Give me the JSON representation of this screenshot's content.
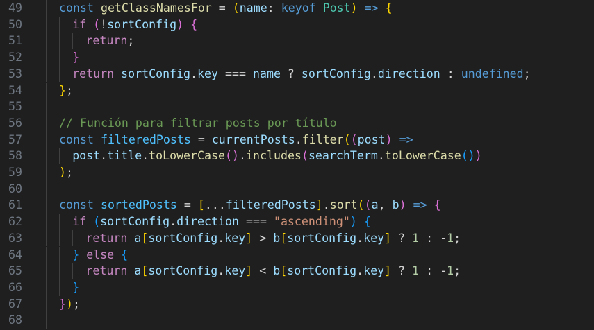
{
  "editor": {
    "line_numbers": [
      "49",
      "50",
      "51",
      "52",
      "53",
      "54",
      "55",
      "56",
      "57",
      "58",
      "59",
      "60",
      "61",
      "62",
      "63",
      "64",
      "65",
      "66",
      "67",
      "68"
    ],
    "lines": [
      {
        "indent": 0,
        "tokens": [
          [
            "kw",
            "const "
          ],
          [
            "fn",
            "getClassNamesFor"
          ],
          [
            "op",
            " = "
          ],
          [
            "b1",
            "("
          ],
          [
            "var",
            "name"
          ],
          [
            "op",
            ": "
          ],
          [
            "kw",
            "keyof "
          ],
          [
            "typ",
            "Post"
          ],
          [
            "b1",
            ")"
          ],
          [
            "op",
            " "
          ],
          [
            "kw",
            "=>"
          ],
          [
            "op",
            " "
          ],
          [
            "b1",
            "{"
          ]
        ]
      },
      {
        "indent": 1,
        "tokens": [
          [
            "ctl",
            "if "
          ],
          [
            "b2",
            "("
          ],
          [
            "op",
            "!"
          ],
          [
            "var",
            "sortConfig"
          ],
          [
            "b2",
            ")"
          ],
          [
            "op",
            " "
          ],
          [
            "b2",
            "{"
          ]
        ]
      },
      {
        "indent": 2,
        "tokens": [
          [
            "ctl",
            "return"
          ],
          [
            "op",
            ";"
          ]
        ]
      },
      {
        "indent": 1,
        "tokens": [
          [
            "b2",
            "}"
          ]
        ]
      },
      {
        "indent": 1,
        "tokens": [
          [
            "ctl",
            "return "
          ],
          [
            "var",
            "sortConfig"
          ],
          [
            "op",
            "."
          ],
          [
            "var",
            "key"
          ],
          [
            "op",
            " === "
          ],
          [
            "var",
            "name"
          ],
          [
            "op",
            " ? "
          ],
          [
            "var",
            "sortConfig"
          ],
          [
            "op",
            "."
          ],
          [
            "var",
            "direction"
          ],
          [
            "op",
            " : "
          ],
          [
            "kw",
            "undefined"
          ],
          [
            "op",
            ";"
          ]
        ]
      },
      {
        "indent": 0,
        "tokens": [
          [
            "b1",
            "}"
          ],
          [
            "op",
            ";"
          ]
        ]
      },
      {
        "indent": 0,
        "tokens": []
      },
      {
        "indent": 0,
        "tokens": [
          [
            "cmt",
            "// Función para filtrar posts por título"
          ]
        ]
      },
      {
        "indent": 0,
        "tokens": [
          [
            "kw",
            "const "
          ],
          [
            "cst",
            "filteredPosts"
          ],
          [
            "op",
            " = "
          ],
          [
            "var",
            "currentPosts"
          ],
          [
            "op",
            "."
          ],
          [
            "fn",
            "filter"
          ],
          [
            "b1",
            "("
          ],
          [
            "b2",
            "("
          ],
          [
            "var",
            "post"
          ],
          [
            "b2",
            ")"
          ],
          [
            "op",
            " "
          ],
          [
            "kw",
            "=>"
          ]
        ]
      },
      {
        "indent": 1,
        "tokens": [
          [
            "var",
            "post"
          ],
          [
            "op",
            "."
          ],
          [
            "var",
            "title"
          ],
          [
            "op",
            "."
          ],
          [
            "fn",
            "toLowerCase"
          ],
          [
            "b2",
            "()"
          ],
          [
            "op",
            "."
          ],
          [
            "fn",
            "includes"
          ],
          [
            "b2",
            "("
          ],
          [
            "var",
            "searchTerm"
          ],
          [
            "op",
            "."
          ],
          [
            "fn",
            "toLowerCase"
          ],
          [
            "b3",
            "()"
          ],
          [
            "b2",
            ")"
          ]
        ]
      },
      {
        "indent": 0,
        "tokens": [
          [
            "b1",
            ")"
          ],
          [
            "op",
            ";"
          ]
        ]
      },
      {
        "indent": 0,
        "tokens": []
      },
      {
        "indent": 0,
        "tokens": [
          [
            "kw",
            "const "
          ],
          [
            "cst",
            "sortedPosts"
          ],
          [
            "op",
            " = "
          ],
          [
            "b1",
            "["
          ],
          [
            "op",
            "..."
          ],
          [
            "var",
            "filteredPosts"
          ],
          [
            "b1",
            "]"
          ],
          [
            "op",
            "."
          ],
          [
            "fn",
            "sort"
          ],
          [
            "b1",
            "("
          ],
          [
            "b2",
            "("
          ],
          [
            "var",
            "a"
          ],
          [
            "op",
            ", "
          ],
          [
            "var",
            "b"
          ],
          [
            "b2",
            ")"
          ],
          [
            "op",
            " "
          ],
          [
            "kw",
            "=>"
          ],
          [
            "op",
            " "
          ],
          [
            "b2",
            "{"
          ]
        ]
      },
      {
        "indent": 1,
        "tokens": [
          [
            "ctl",
            "if "
          ],
          [
            "b3",
            "("
          ],
          [
            "var",
            "sortConfig"
          ],
          [
            "op",
            "."
          ],
          [
            "var",
            "direction"
          ],
          [
            "op",
            " === "
          ],
          [
            "str",
            "\"ascending\""
          ],
          [
            "b3",
            ")"
          ],
          [
            "op",
            " "
          ],
          [
            "b3",
            "{"
          ]
        ]
      },
      {
        "indent": 2,
        "tokens": [
          [
            "ctl",
            "return "
          ],
          [
            "var",
            "a"
          ],
          [
            "b1",
            "["
          ],
          [
            "var",
            "sortConfig"
          ],
          [
            "op",
            "."
          ],
          [
            "var",
            "key"
          ],
          [
            "b1",
            "]"
          ],
          [
            "op",
            " > "
          ],
          [
            "var",
            "b"
          ],
          [
            "b1",
            "["
          ],
          [
            "var",
            "sortConfig"
          ],
          [
            "op",
            "."
          ],
          [
            "var",
            "key"
          ],
          [
            "b1",
            "]"
          ],
          [
            "op",
            " ? "
          ],
          [
            "num",
            "1"
          ],
          [
            "op",
            " : "
          ],
          [
            "op",
            "-"
          ],
          [
            "num",
            "1"
          ],
          [
            "op",
            ";"
          ]
        ]
      },
      {
        "indent": 1,
        "tokens": [
          [
            "b3",
            "}"
          ],
          [
            "op",
            " "
          ],
          [
            "ctl",
            "else "
          ],
          [
            "b3",
            "{"
          ]
        ]
      },
      {
        "indent": 2,
        "tokens": [
          [
            "ctl",
            "return "
          ],
          [
            "var",
            "a"
          ],
          [
            "b1",
            "["
          ],
          [
            "var",
            "sortConfig"
          ],
          [
            "op",
            "."
          ],
          [
            "var",
            "key"
          ],
          [
            "b1",
            "]"
          ],
          [
            "op",
            " < "
          ],
          [
            "var",
            "b"
          ],
          [
            "b1",
            "["
          ],
          [
            "var",
            "sortConfig"
          ],
          [
            "op",
            "."
          ],
          [
            "var",
            "key"
          ],
          [
            "b1",
            "]"
          ],
          [
            "op",
            " ? "
          ],
          [
            "num",
            "1"
          ],
          [
            "op",
            " : "
          ],
          [
            "op",
            "-"
          ],
          [
            "num",
            "1"
          ],
          [
            "op",
            ";"
          ]
        ]
      },
      {
        "indent": 1,
        "tokens": [
          [
            "b3",
            "}"
          ]
        ]
      },
      {
        "indent": 0,
        "tokens": [
          [
            "b2",
            "}"
          ],
          [
            "b1",
            ")"
          ],
          [
            "op",
            ";"
          ]
        ]
      },
      {
        "indent": 0,
        "tokens": []
      }
    ],
    "guide_levels": [
      1,
      2,
      3,
      2,
      2,
      1,
      1,
      1,
      1,
      2,
      1,
      1,
      1,
      2,
      3,
      2,
      3,
      2,
      1,
      1
    ]
  }
}
